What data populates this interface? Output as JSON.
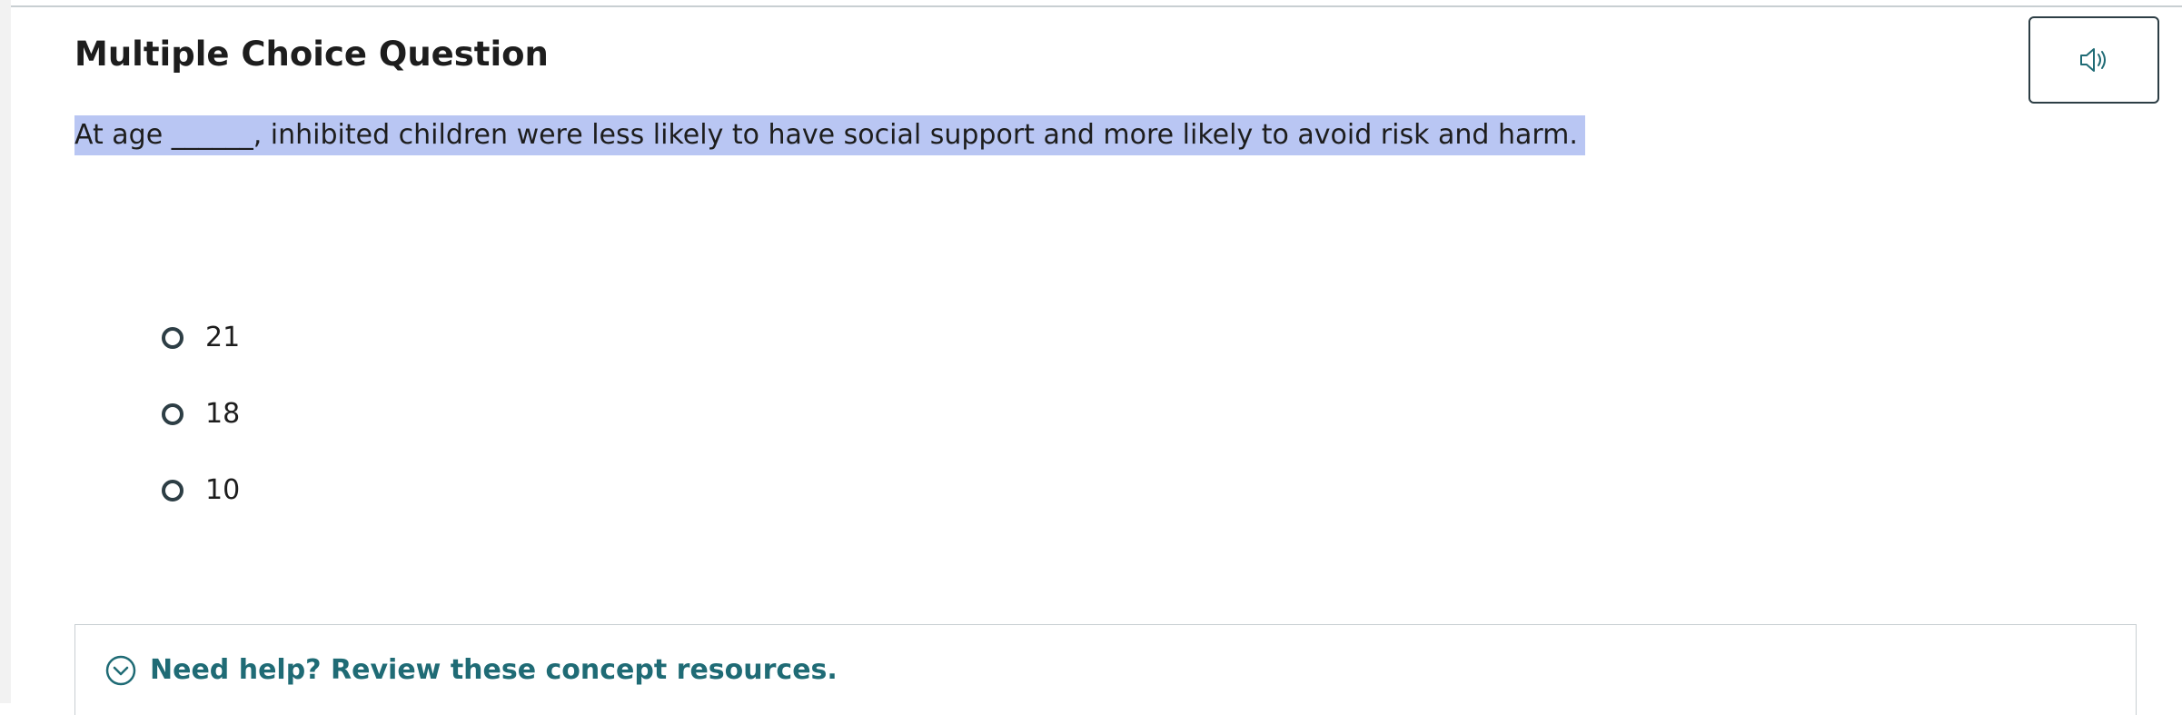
{
  "question": {
    "title": "Multiple Choice Question",
    "prompt": "At age ______, inhibited children were less likely to have social support and more likely to avoid risk and harm.",
    "options": [
      {
        "label": "21"
      },
      {
        "label": "18"
      },
      {
        "label": "10"
      }
    ]
  },
  "toolbar": {
    "audio_icon": "speaker-icon"
  },
  "help": {
    "label": "Need help? Review these concept resources.",
    "icon": "chevron-down-circle-icon"
  },
  "colors": {
    "accent": "#1f6b75",
    "highlight": "#b9c6f3",
    "border": "#2d3e45"
  }
}
